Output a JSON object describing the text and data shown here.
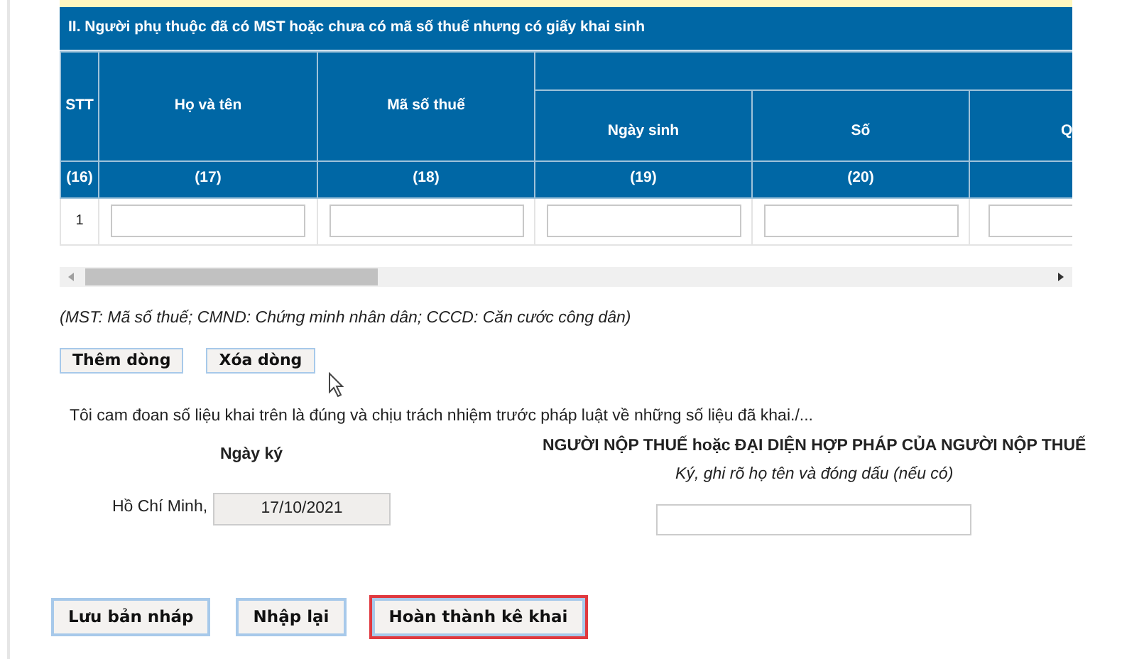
{
  "section_title": "II. Người phụ thuộc đã có MST hoặc chưa có mã số thuế nhưng có giấy khai sinh",
  "columns": [
    {
      "label": "STT",
      "number": "(16)"
    },
    {
      "label": "Họ và tên",
      "number": "(17)"
    },
    {
      "label": "Mã số thuế",
      "number": "(18)"
    },
    {
      "label": "Ngày sinh",
      "number": "(19)"
    },
    {
      "label": "Số",
      "number": "(20)"
    },
    {
      "label": "Q"
    }
  ],
  "rows": [
    {
      "stt": "1"
    }
  ],
  "note": "(MST: Mã số thuế; CMND: Chứng minh nhân dân; CCCD: Căn cước công dân)",
  "row_buttons": [
    "Thêm dòng",
    "Xóa dòng"
  ],
  "statement": "Tôi cam đoan số liệu khai trên là đúng và chịu trách nhiệm trước pháp luật về những số liệu đã khai./...",
  "sign_date": {
    "label": "Ngày ký",
    "place": "Hồ Chí Minh,",
    "value": "17/10/2021"
  },
  "signer": {
    "title": "NGƯỜI NỘP THUẾ hoặc ĐẠI DIỆN HỢP PHÁP CỦA NGƯỜI NỘP THUẾ",
    "hint": "Ký, ghi rõ họ tên và đóng dấu (nếu có)"
  },
  "actions": [
    {
      "label": "Lưu bản nháp",
      "highlighted": false
    },
    {
      "label": "Nhập lại",
      "highlighted": false
    },
    {
      "label": "Hoàn thành kê khai",
      "highlighted": true
    }
  ]
}
